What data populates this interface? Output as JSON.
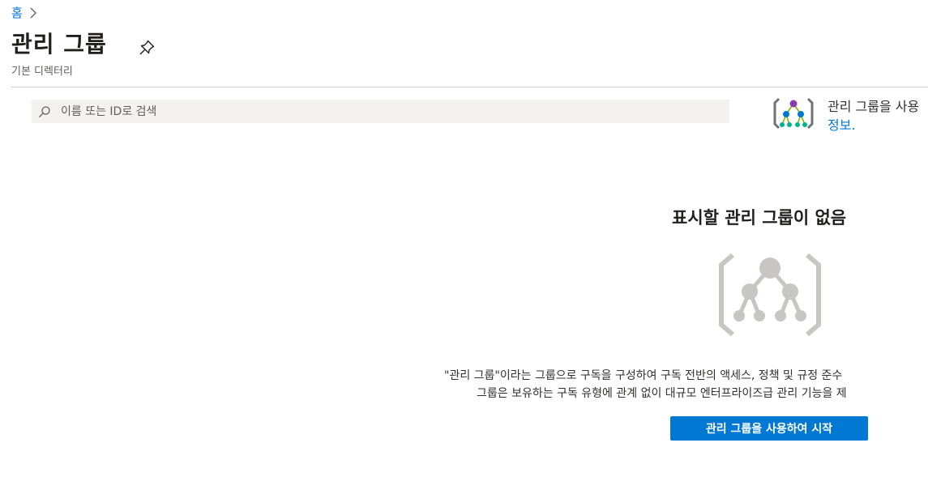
{
  "breadcrumb": {
    "home_label": "홈"
  },
  "header": {
    "title": "관리 그룹",
    "subtitle": "기본 디렉터리"
  },
  "search": {
    "placeholder": "이름 또는 ID로 검색",
    "value": ""
  },
  "info_panel": {
    "text": "관리 그룹을 사용",
    "link_label": "정보."
  },
  "empty_state": {
    "title": "표시할 관리 그룹이 없음",
    "description_line1": "\"관리 그룹\"이라는 그룹으로 구독을 구성하여 구독 전반의 액세스, 정책 및 규정 준수",
    "description_line2": "그룹은 보유하는 구독 유형에 관계 없이 대규모 엔터프라이즈급 관리 기능을 제",
    "button_label": "관리 그룹을 사용하여 시작"
  },
  "colors": {
    "accent": "#0078d4",
    "search_bg": "#f3f2f1",
    "divider": "#d2d0ce",
    "illustration_gray": "#c8c6c4",
    "icon_purple": "#8a3bb0",
    "icon_blue": "#0078d4",
    "icon_green": "#7fba00"
  },
  "icons": {
    "breadcrumb_separator": "chevron-right-icon",
    "pin": "pin-icon",
    "search": "search-icon",
    "info": "management-groups-icon",
    "empty": "management-groups-illustration"
  }
}
